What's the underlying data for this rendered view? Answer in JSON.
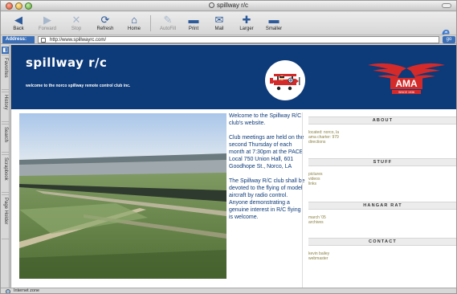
{
  "window": {
    "title": "spillway r/c"
  },
  "toolbar": {
    "back": "Back",
    "forward": "Forward",
    "stop": "Stop",
    "refresh": "Refresh",
    "home": "Home",
    "autofill": "AutoFill",
    "print": "Print",
    "mail": "Mail",
    "larger": "Larger",
    "smaller": "Smaller"
  },
  "address": {
    "label": "Address:",
    "url": "http://www.spillwayrc.com/",
    "go": "go"
  },
  "sidebar": {
    "tabs": [
      "Favorites",
      "History",
      "Search",
      "Scrapbook",
      "Page Holder"
    ]
  },
  "site": {
    "title": "spillway r/c",
    "tagline": "welcome to the norco spillway remote control club inc.",
    "ama": {
      "text": "AMA",
      "since": "SINCE 1936"
    },
    "welcome": [
      "Welcome to the Spillway R/C club's website.",
      "Club meetings are held on the second Thursday of each month at 7:30pm at the PACE Local 750 Union Hall, 601 Goodhope St., Norco, LA",
      "The Spillway R/C club shall be devoted to the flying of model aircraft by radio control. Anyone demonstrating a genuine interest in R/C flying is welcome."
    ],
    "sections": [
      {
        "title": "ABOUT",
        "links": [
          "located: norco, la",
          "ama charter: 979",
          "directions"
        ]
      },
      {
        "title": "STUFF",
        "links": [
          "pictures",
          "videos",
          "links"
        ]
      },
      {
        "title": "HANGAR RAT",
        "links": [
          "march '05",
          "archives"
        ]
      },
      {
        "title": "CONTACT",
        "links": [
          "kevin bailey",
          "webmaster"
        ]
      }
    ]
  },
  "status": {
    "text": "Internet zone"
  },
  "colors": {
    "header_blue": "#0d3a78",
    "link_olive": "#8a8044",
    "ama_red": "#d42a2a"
  }
}
